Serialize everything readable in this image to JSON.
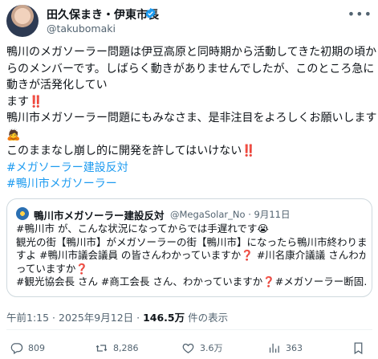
{
  "author": {
    "name": "田久保まき・伊東市長",
    "handle": "@takubomaki"
  },
  "post": {
    "lines": [
      "鴨川のメガソーラー問題は伊豆高原と同時期から活動してきた初期の頃か",
      "らのメンバーです。しばらく動きがありませんでしたが、このところ急に",
      "動きが活発化してい",
      "ます‼️",
      "鴨川市メガソーラー問題にもみなさま、是非注目をよろしくお願いします",
      "🙇",
      "このままなし崩し的に開発を許してはいけない‼️"
    ],
    "hashtags": [
      "#メガソーラー建設反対",
      "#鴨川市メガソーラー"
    ]
  },
  "quote": {
    "name": "鴨川市メガソーラー建設反対",
    "handle_date": "@MegaSolar_No · 9月11日",
    "lines": [
      "#鴨川市 が、こんな状況になってからでは手遅れです😭",
      "観光の街【鴨川市】がメガソーラーの街【鴨川市】になったら鴨川市終わりま",
      "すよ #鴨川市議会議員 の皆さんわかっていますか❓ #川名康介議議 さんわか",
      "っていますか❓",
      " #観光協会長 さん #商工会長 さん、わかっていますか❓#メガソーラー断固…"
    ]
  },
  "meta": {
    "time_date": "午前1:15 · 2025年9月12日 · ",
    "views_count": "146.5万",
    "views_label": " 件の表示"
  },
  "actions": {
    "reply_count": "809",
    "repost_count": "8,286",
    "like_count": "3.6万",
    "views_count": "363"
  },
  "icons": {
    "verified": "verified-badge-icon",
    "more": "more-icon",
    "reply": "reply-icon",
    "repost": "repost-icon",
    "like": "like-icon",
    "views": "views-icon",
    "bookmark": "bookmark-icon"
  },
  "colors": {
    "accent": "#1d9bf0",
    "text": "#0f1419",
    "muted": "#536471",
    "border": "#cfd9de"
  }
}
